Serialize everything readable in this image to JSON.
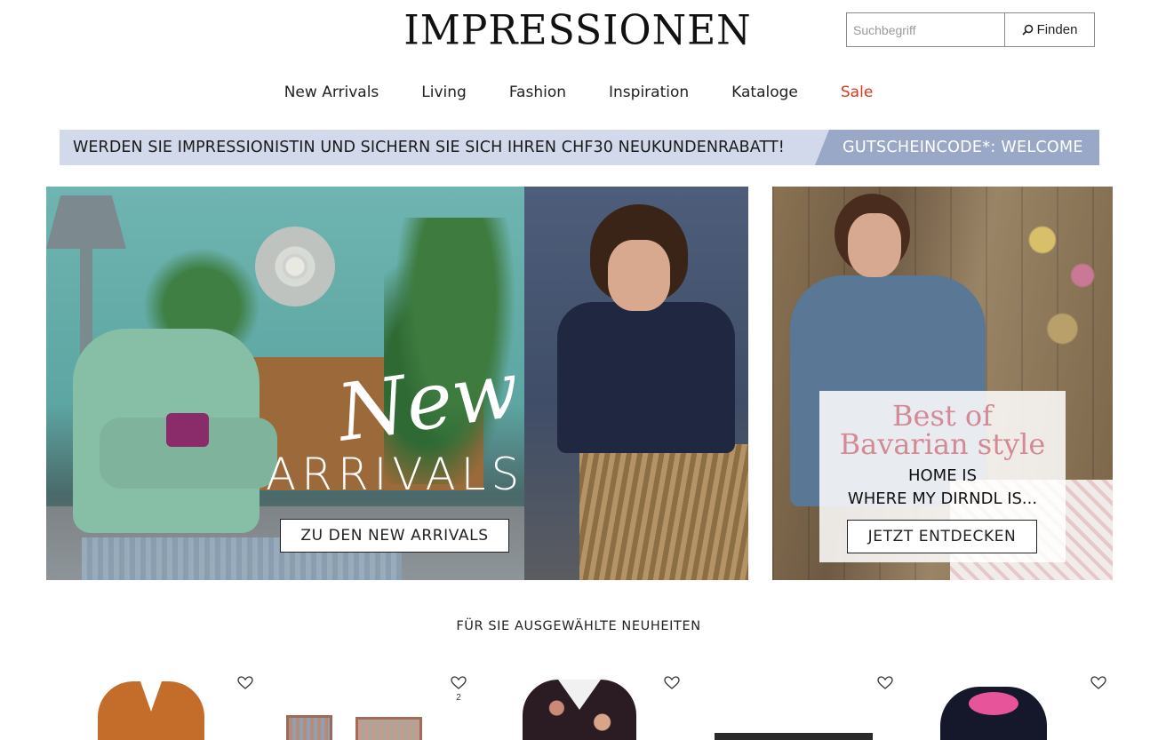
{
  "header": {
    "logo": "IMPRESSIONEN",
    "search": {
      "placeholder": "Suchbegriff",
      "button_label": "Finden"
    }
  },
  "nav": {
    "items": [
      "New Arrivals",
      "Living",
      "Fashion",
      "Inspiration",
      "Kataloge",
      "Sale"
    ],
    "sale_color": "#d93a1c"
  },
  "promo": {
    "text": "WERDEN SIE IMPRESSIONISTIN UND SICHERN SIE SICH IHREN CHF30 NEUKUNDENRABATT!",
    "code": "GUTSCHEINCODE*:  WELCOME"
  },
  "hero_left": {
    "script_title": "New",
    "title": "ARRIVALS",
    "button": "ZU DEN NEW ARRIVALS"
  },
  "hero_right": {
    "title_line1": "Best of",
    "title_line2": "Bavarian style",
    "sub_line1": "HOME IS",
    "sub_line2": "WHERE MY DIRNDL IS...",
    "button": "JETZT ENTDECKEN"
  },
  "section": {
    "title": "FÜR SIE AUSGEWÄHLTE NEUHEITEN"
  },
  "products": [
    {
      "name": "orange-blouse",
      "fav_count": ""
    },
    {
      "name": "rugs",
      "fav_count": "2"
    },
    {
      "name": "floral-sweater",
      "fav_count": ""
    },
    {
      "name": "dark-tray",
      "fav_count": ""
    },
    {
      "name": "navy-hoodie",
      "fav_count": ""
    }
  ],
  "colors": {
    "brand_text": "#111111",
    "promo_bg": "#d2d9ea",
    "promo_code_bg": "#9aa8c8",
    "bavarian_pink": "#d48a95"
  }
}
